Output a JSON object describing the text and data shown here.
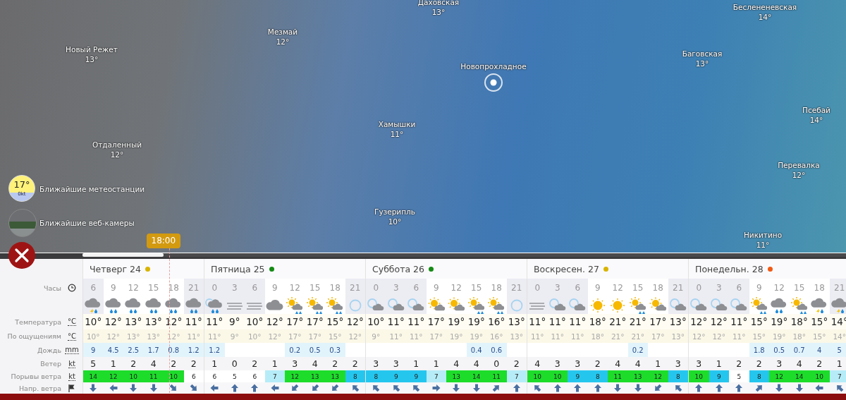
{
  "map": {
    "towns": [
      {
        "name": "Даховская",
        "temp": "13°"
      },
      {
        "name": "Беслененевская",
        "temp": "14°"
      },
      {
        "name": "Мезмай",
        "temp": "12°"
      },
      {
        "name": "Новый Режет",
        "temp": "13°"
      },
      {
        "name": "Новопрохладное"
      },
      {
        "name": "Баговская",
        "temp": "13°"
      },
      {
        "name": "Псебай",
        "temp": "14°"
      },
      {
        "name": "Хамышки",
        "temp": "11°"
      },
      {
        "name": "Отдаленный",
        "temp": "12°"
      },
      {
        "name": "Перевалка",
        "temp": "12°"
      },
      {
        "name": "Гузерипль",
        "temp": "10°"
      },
      {
        "name": "Никитино",
        "temp": "11°"
      }
    ]
  },
  "station": {
    "temp": "17°",
    "wind": "0kt",
    "label": "Ближайшие метеостанции"
  },
  "webcams": {
    "label": "Ближайшие веб-камеры"
  },
  "timeline": {
    "time": "18:00",
    "level": 0.106
  },
  "row_labels": [
    {
      "kind": "hours",
      "label": "Часы"
    },
    {
      "kind": "icons"
    },
    {
      "kind": "temperature",
      "label": "Температура",
      "unit": "°C"
    },
    {
      "kind": "feels",
      "label": "По ощущениям",
      "unit": "°C"
    },
    {
      "kind": "rain",
      "label": "Дождь",
      "unit": "mm"
    },
    {
      "kind": "wind",
      "label": "Ветер",
      "unit": "kt"
    },
    {
      "kind": "gusts",
      "label": "Порывы ветра",
      "unit": "kt"
    },
    {
      "kind": "direction",
      "label": "Напр. ветра"
    }
  ],
  "days": [
    {
      "title": "Четверг 24",
      "color": "#d8b400",
      "hours": [
        {
          "hour": "6",
          "night": true,
          "kind": "thunder-rain",
          "temp": "10°",
          "feels": "10°",
          "rain": "9",
          "wind": "5",
          "gust": "14",
          "arrow": {
            "kind": "s"
          }
        },
        {
          "hour": "9",
          "night": false,
          "kind": "rain-cloud",
          "temp": "12°",
          "feels": "12°",
          "rain": "4.5",
          "wind": "1",
          "gust": "12",
          "arrow": {
            "kind": "w"
          }
        },
        {
          "hour": "12",
          "night": false,
          "kind": "rain-cloud",
          "temp": "13°",
          "feels": "13°",
          "rain": "2.5",
          "wind": "2",
          "gust": "10",
          "arrow": {
            "kind": "s"
          }
        },
        {
          "hour": "15",
          "night": false,
          "kind": "rain-cloud",
          "temp": "13°",
          "feels": "13°",
          "rain": "1.7",
          "wind": "4",
          "gust": "11",
          "arrow": {
            "kind": "s"
          }
        },
        {
          "hour": "18",
          "night": false,
          "kind": "rain-cloud",
          "temp": "12°",
          "feels": "12°",
          "rain": "0.8",
          "wind": "2",
          "gust": "10",
          "arrow": {
            "kind": "se"
          }
        },
        {
          "hour": "21",
          "night": true,
          "kind": "rain-cloud",
          "temp": "11°",
          "feels": "11°",
          "rain": "1.2",
          "wind": "2",
          "gust": "6",
          "arrow": {
            "kind": "se"
          }
        }
      ]
    },
    {
      "title": "Пятница 25",
      "color": "#148a14",
      "hours": [
        {
          "hour": "0",
          "night": true,
          "kind": "moon-rain",
          "temp": "11°",
          "feels": "11°",
          "rain": "1.2",
          "wind": "1",
          "gust": "6",
          "arrow": {
            "kind": "w"
          }
        },
        {
          "hour": "3",
          "night": true,
          "kind": "fog",
          "temp": "9°",
          "feels": "9°",
          "wind": "0",
          "gust": "5",
          "arrow": {
            "kind": "n"
          }
        },
        {
          "hour": "6",
          "night": true,
          "kind": "fog",
          "temp": "10°",
          "feels": "10°",
          "wind": "2",
          "gust": "6",
          "arrow": {
            "kind": "n"
          }
        },
        {
          "hour": "9",
          "night": false,
          "kind": "cloud",
          "temp": "12°",
          "feels": "12°",
          "wind": "1",
          "gust": "7",
          "arrow": {
            "kind": "w"
          }
        },
        {
          "hour": "12",
          "night": false,
          "kind": "sun-rain",
          "temp": "17°",
          "feels": "17°",
          "rain": "0.2",
          "wind": "3",
          "gust": "12",
          "arrow": {
            "kind": "sw"
          }
        },
        {
          "hour": "15",
          "night": false,
          "kind": "sun-rain",
          "temp": "17°",
          "feels": "17°",
          "rain": "0.5",
          "wind": "4",
          "gust": "13",
          "arrow": {
            "kind": "sw"
          }
        },
        {
          "hour": "18",
          "night": false,
          "kind": "sun-rain",
          "temp": "15°",
          "feels": "15°",
          "rain": "0.3",
          "wind": "2",
          "gust": "13",
          "arrow": {
            "kind": "sw"
          }
        },
        {
          "hour": "21",
          "night": true,
          "kind": "moon",
          "temp": "12°",
          "feels": "12°",
          "wind": "2",
          "gust": "8",
          "arrow": {
            "kind": "nw"
          }
        }
      ]
    },
    {
      "title": "Суббота 26",
      "color": "#148a14",
      "hours": [
        {
          "hour": "0",
          "night": true,
          "kind": "moon-cloud",
          "temp": "10°",
          "feels": "9°",
          "wind": "3",
          "gust": "8",
          "arrow": {
            "kind": "nw"
          }
        },
        {
          "hour": "3",
          "night": true,
          "kind": "moon-cloud",
          "temp": "11°",
          "feels": "11°",
          "wind": "3",
          "gust": "9",
          "arrow": {
            "kind": "nw"
          }
        },
        {
          "hour": "6",
          "night": true,
          "kind": "moon-cloud",
          "temp": "11°",
          "feels": "11°",
          "wind": "1",
          "gust": "9",
          "arrow": {
            "kind": "nw"
          }
        },
        {
          "hour": "9",
          "night": false,
          "kind": "sun-cloud",
          "temp": "17°",
          "feels": "17°",
          "wind": "1",
          "gust": "7",
          "arrow": {
            "kind": "e"
          }
        },
        {
          "hour": "12",
          "night": false,
          "kind": "sun-cloud",
          "temp": "19°",
          "feels": "19°",
          "wind": "4",
          "gust": "13",
          "arrow": {
            "kind": "s"
          }
        },
        {
          "hour": "15",
          "night": false,
          "kind": "sun-rain",
          "temp": "19°",
          "feels": "19°",
          "rain": "0.4",
          "wind": "4",
          "gust": "14",
          "arrow": {
            "kind": "s"
          }
        },
        {
          "hour": "18",
          "night": false,
          "kind": "sun-rain",
          "temp": "16°",
          "feels": "16°",
          "rain": "0.6",
          "wind": "0",
          "gust": "11",
          "arrow": {
            "kind": "ne"
          }
        },
        {
          "hour": "21",
          "night": true,
          "kind": "moon",
          "temp": "13°",
          "feels": "13°",
          "wind": "2",
          "gust": "7",
          "arrow": {
            "kind": "n"
          }
        }
      ]
    },
    {
      "title": "Воскресен. 27",
      "color": "#d8b400",
      "hours": [
        {
          "hour": "0",
          "night": true,
          "kind": "fog",
          "temp": "11°",
          "feels": "11°",
          "wind": "4",
          "gust": "10",
          "arrow": {
            "kind": "nw"
          }
        },
        {
          "hour": "3",
          "night": true,
          "kind": "moon-cloud",
          "temp": "11°",
          "feels": "11°",
          "wind": "3",
          "gust": "10",
          "arrow": {
            "kind": "n"
          }
        },
        {
          "hour": "6",
          "night": true,
          "kind": "moon-cloud",
          "temp": "11°",
          "feels": "11°",
          "wind": "3",
          "gust": "9",
          "arrow": {
            "kind": "n"
          }
        },
        {
          "hour": "9",
          "night": false,
          "kind": "sun",
          "temp": "18°",
          "feels": "18°",
          "wind": "2",
          "gust": "8",
          "arrow": {
            "kind": "n"
          }
        },
        {
          "hour": "12",
          "night": false,
          "kind": "sun",
          "temp": "21°",
          "feels": "21°",
          "wind": "4",
          "gust": "11",
          "arrow": {
            "kind": "s"
          }
        },
        {
          "hour": "15",
          "night": false,
          "kind": "sun-rain",
          "temp": "21°",
          "feels": "21°",
          "rain": "0.2",
          "wind": "4",
          "gust": "13",
          "arrow": {
            "kind": "s"
          }
        },
        {
          "hour": "18",
          "night": false,
          "kind": "sun-cloud",
          "temp": "17°",
          "feels": "17°",
          "wind": "1",
          "gust": "12",
          "arrow": {
            "kind": "sw"
          }
        },
        {
          "hour": "21",
          "night": true,
          "kind": "moon-cloud",
          "temp": "13°",
          "feels": "13°",
          "wind": "3",
          "gust": "8",
          "arrow": {
            "kind": "nw"
          }
        }
      ]
    },
    {
      "title": "Понедельн. 28",
      "color": "#f05a14",
      "hours": [
        {
          "hour": "0",
          "night": true,
          "kind": "moon-cloud",
          "temp": "12°",
          "feels": "12°",
          "wind": "3",
          "gust": "10",
          "arrow": {
            "kind": "n"
          }
        },
        {
          "hour": "3",
          "night": true,
          "kind": "moon-cloud",
          "temp": "12°",
          "feels": "12°",
          "wind": "1",
          "gust": "9",
          "arrow": {
            "kind": "n"
          }
        },
        {
          "hour": "6",
          "night": true,
          "kind": "moon-cloud",
          "temp": "11°",
          "feels": "11°",
          "wind": "2",
          "gust": "5",
          "arrow": {
            "kind": "n"
          }
        },
        {
          "hour": "9",
          "night": false,
          "kind": "sun-rain",
          "temp": "15°",
          "feels": "15°",
          "rain": "1.8",
          "wind": "2",
          "gust": "8",
          "arrow": {
            "kind": "ne"
          }
        },
        {
          "hour": "12",
          "night": false,
          "kind": "rain-cloud",
          "temp": "19°",
          "feels": "19°",
          "rain": "0.5",
          "wind": "3",
          "gust": "12",
          "arrow": {
            "kind": "s"
          }
        },
        {
          "hour": "15",
          "night": false,
          "kind": "sun-rain",
          "temp": "18°",
          "feels": "18°",
          "rain": "0.7",
          "wind": "4",
          "gust": "14",
          "arrow": {
            "kind": "s"
          }
        },
        {
          "hour": "18",
          "night": false,
          "kind": "thunder-rain",
          "temp": "15°",
          "feels": "15°",
          "rain": "4",
          "wind": "2",
          "gust": "10",
          "arrow": {
            "kind": "w"
          }
        },
        {
          "hour": "21",
          "night": true,
          "kind": "thunder-rain",
          "temp": "14°",
          "feels": "14°",
          "rain": "5",
          "wind": "1",
          "gust": "7",
          "arrow": {
            "kind": "nw"
          }
        }
      ]
    }
  ]
}
